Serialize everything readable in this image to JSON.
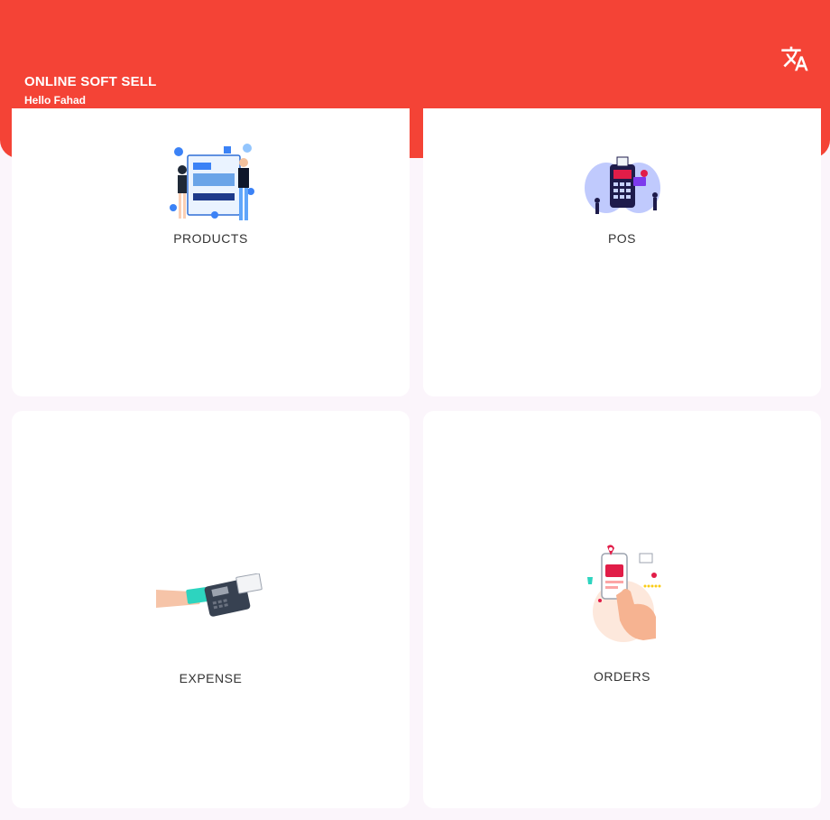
{
  "header": {
    "app_title": "ONLINE SOFT SELL",
    "greeting": "Hello Fahad",
    "translate_icon": "translate-icon",
    "background_color": "#f44336"
  },
  "menu": [
    {
      "key": "products",
      "label": "PRODUCTS",
      "icon": "products-illustration"
    },
    {
      "key": "pos",
      "label": "POS",
      "icon": "pos-terminal-illustration"
    },
    {
      "key": "expense",
      "label": "EXPENSE",
      "icon": "card-payment-illustration"
    },
    {
      "key": "orders",
      "label": "ORDERS",
      "icon": "mobile-shopping-illustration"
    }
  ]
}
